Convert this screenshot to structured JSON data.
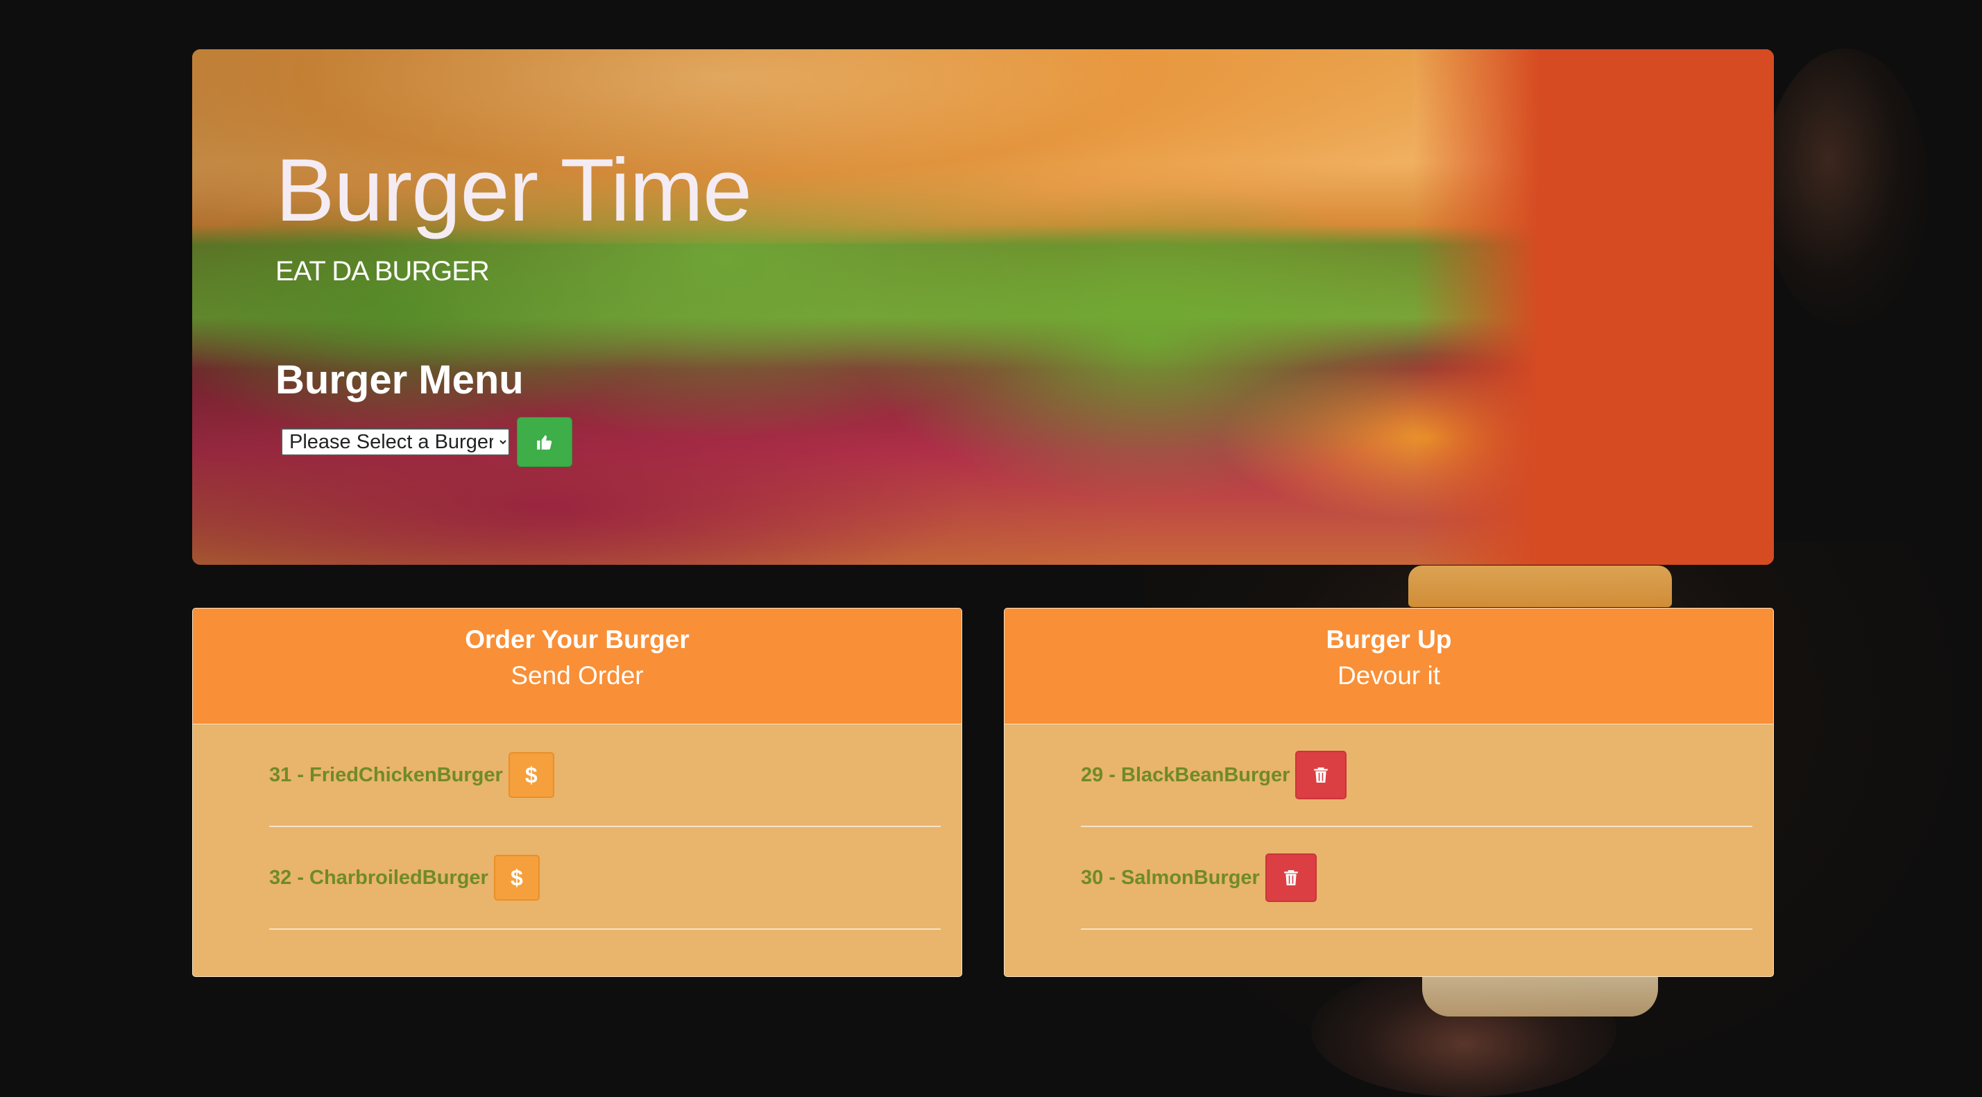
{
  "hero": {
    "title": "Burger Time",
    "subtitle": "EAT DA BURGER",
    "menu_title": "Burger Menu",
    "select_value": "Please Select a Burger",
    "submit_icon": "thumbs-up-icon"
  },
  "order_panel": {
    "title": "Order Your Burger",
    "subtitle": "Send Order",
    "items": [
      {
        "label": "31 - FriedChickenBurger",
        "button_text": "$"
      },
      {
        "label": "32 - CharbroiledBurger",
        "button_text": "$"
      }
    ]
  },
  "devour_panel": {
    "title": "Burger Up",
    "subtitle": "Devour it",
    "items": [
      {
        "label": "29 - BlackBeanBurger",
        "button_icon": "trash-icon"
      },
      {
        "label": "30 - SalmonBurger",
        "button_icon": "trash-icon"
      }
    ]
  },
  "colors": {
    "page_background": "#0e0e0e",
    "panel_header": "#f98f37",
    "panel_body": "#e9b46c",
    "item_text": "#6f8b28",
    "buy_button": "#f5a03c",
    "delete_button": "#dc3f43",
    "like_button": "#3dae48",
    "hero_accent": "#d64b22"
  }
}
